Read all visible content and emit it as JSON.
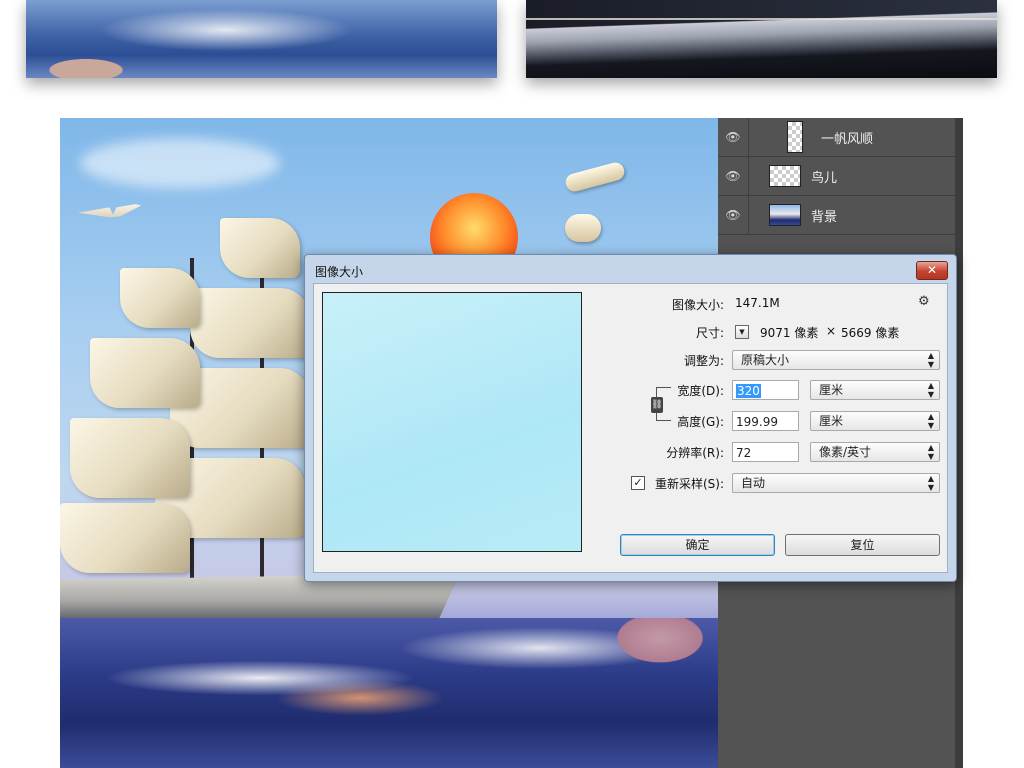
{
  "layers": [
    {
      "name": "一帆风顺",
      "visible_icon": "eye-icon"
    },
    {
      "name": "鸟儿",
      "visible_icon": "eye-icon"
    },
    {
      "name": "背景",
      "visible_icon": "eye-icon"
    }
  ],
  "dialog": {
    "title": "图像大小",
    "close_label": "✕",
    "image_size_label": "图像大小:",
    "image_size_value": "147.1M",
    "dimensions_label": "尺寸:",
    "dimensions_width": "9071 像素",
    "dimensions_times": "×",
    "dimensions_height": "5669 像素",
    "fit_to_label": "调整为:",
    "fit_to_value": "原稿大小",
    "width_label": "宽度(D):",
    "width_value": "320",
    "width_unit": "厘米",
    "height_label": "高度(G):",
    "height_value": "199.99",
    "height_unit": "厘米",
    "resolution_label": "分辨率(R):",
    "resolution_value": "72",
    "resolution_unit": "像素/英寸",
    "resample_label": "重新采样(S):",
    "resample_checked": "✓",
    "resample_value": "自动",
    "ok_label": "确定",
    "reset_label": "复位"
  },
  "colors": {
    "panel_bg": "#535353",
    "dialog_frame": "#c5d6ea",
    "close_button": "#c4432d",
    "preview_fill": "#aee7f6",
    "selection": "#3399ff"
  }
}
